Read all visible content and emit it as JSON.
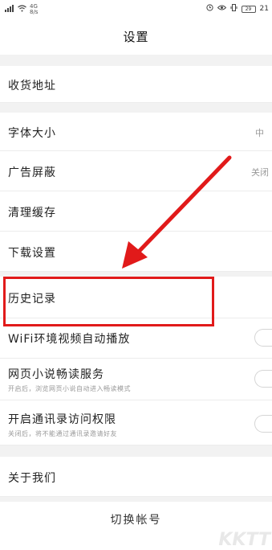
{
  "status_bar": {
    "signal": "4G",
    "speed": "8/s",
    "time": "21",
    "battery": "29"
  },
  "header": {
    "title": "设置"
  },
  "rows": [
    {
      "label": "收货地址"
    },
    {
      "label": "字体大小",
      "value": "中"
    },
    {
      "label": "广告屏蔽",
      "value": "关闭"
    },
    {
      "label": "清理缓存"
    },
    {
      "label": "下载设置"
    },
    {
      "label": "历史记录"
    },
    {
      "label": "WiFi环境视频自动播放",
      "toggle": false
    },
    {
      "label": "网页小说畅读服务",
      "sub": "开启后，浏览网页小说自动进入畅读模式",
      "toggle": false
    },
    {
      "label": "开启通讯录访问权限",
      "sub": "关闭后，将不能通过通讯录邀请好友",
      "toggle": false
    },
    {
      "label": "关于我们"
    }
  ],
  "logout": {
    "label": "切换帐号"
  },
  "watermark": "KKTT",
  "colors": {
    "highlight": "#e11a1a",
    "arrow": "#e11a1a"
  }
}
